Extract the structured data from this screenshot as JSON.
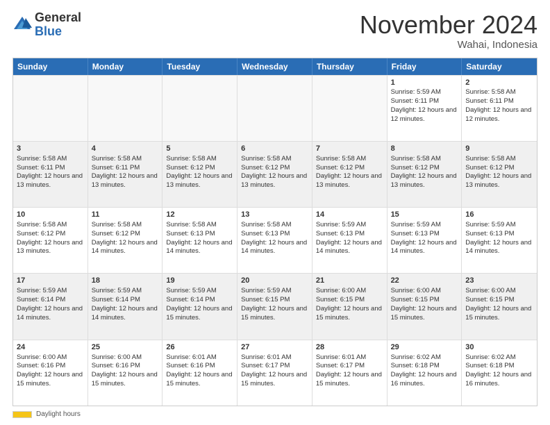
{
  "logo": {
    "general": "General",
    "blue": "Blue"
  },
  "title": "November 2024",
  "location": "Wahai, Indonesia",
  "days_header": [
    "Sunday",
    "Monday",
    "Tuesday",
    "Wednesday",
    "Thursday",
    "Friday",
    "Saturday"
  ],
  "footer": {
    "daylight_label": "Daylight hours"
  },
  "weeks": [
    [
      {
        "day": "",
        "sunrise": "",
        "sunset": "",
        "daylight": "",
        "empty": true
      },
      {
        "day": "",
        "sunrise": "",
        "sunset": "",
        "daylight": "",
        "empty": true
      },
      {
        "day": "",
        "sunrise": "",
        "sunset": "",
        "daylight": "",
        "empty": true
      },
      {
        "day": "",
        "sunrise": "",
        "sunset": "",
        "daylight": "",
        "empty": true
      },
      {
        "day": "",
        "sunrise": "",
        "sunset": "",
        "daylight": "",
        "empty": true
      },
      {
        "day": "1",
        "sunrise": "Sunrise: 5:59 AM",
        "sunset": "Sunset: 6:11 PM",
        "daylight": "Daylight: 12 hours and 12 minutes.",
        "empty": false
      },
      {
        "day": "2",
        "sunrise": "Sunrise: 5:58 AM",
        "sunset": "Sunset: 6:11 PM",
        "daylight": "Daylight: 12 hours and 12 minutes.",
        "empty": false
      }
    ],
    [
      {
        "day": "3",
        "sunrise": "Sunrise: 5:58 AM",
        "sunset": "Sunset: 6:11 PM",
        "daylight": "Daylight: 12 hours and 13 minutes.",
        "empty": false
      },
      {
        "day": "4",
        "sunrise": "Sunrise: 5:58 AM",
        "sunset": "Sunset: 6:11 PM",
        "daylight": "Daylight: 12 hours and 13 minutes.",
        "empty": false
      },
      {
        "day": "5",
        "sunrise": "Sunrise: 5:58 AM",
        "sunset": "Sunset: 6:12 PM",
        "daylight": "Daylight: 12 hours and 13 minutes.",
        "empty": false
      },
      {
        "day": "6",
        "sunrise": "Sunrise: 5:58 AM",
        "sunset": "Sunset: 6:12 PM",
        "daylight": "Daylight: 12 hours and 13 minutes.",
        "empty": false
      },
      {
        "day": "7",
        "sunrise": "Sunrise: 5:58 AM",
        "sunset": "Sunset: 6:12 PM",
        "daylight": "Daylight: 12 hours and 13 minutes.",
        "empty": false
      },
      {
        "day": "8",
        "sunrise": "Sunrise: 5:58 AM",
        "sunset": "Sunset: 6:12 PM",
        "daylight": "Daylight: 12 hours and 13 minutes.",
        "empty": false
      },
      {
        "day": "9",
        "sunrise": "Sunrise: 5:58 AM",
        "sunset": "Sunset: 6:12 PM",
        "daylight": "Daylight: 12 hours and 13 minutes.",
        "empty": false
      }
    ],
    [
      {
        "day": "10",
        "sunrise": "Sunrise: 5:58 AM",
        "sunset": "Sunset: 6:12 PM",
        "daylight": "Daylight: 12 hours and 13 minutes.",
        "empty": false
      },
      {
        "day": "11",
        "sunrise": "Sunrise: 5:58 AM",
        "sunset": "Sunset: 6:12 PM",
        "daylight": "Daylight: 12 hours and 14 minutes.",
        "empty": false
      },
      {
        "day": "12",
        "sunrise": "Sunrise: 5:58 AM",
        "sunset": "Sunset: 6:13 PM",
        "daylight": "Daylight: 12 hours and 14 minutes.",
        "empty": false
      },
      {
        "day": "13",
        "sunrise": "Sunrise: 5:58 AM",
        "sunset": "Sunset: 6:13 PM",
        "daylight": "Daylight: 12 hours and 14 minutes.",
        "empty": false
      },
      {
        "day": "14",
        "sunrise": "Sunrise: 5:59 AM",
        "sunset": "Sunset: 6:13 PM",
        "daylight": "Daylight: 12 hours and 14 minutes.",
        "empty": false
      },
      {
        "day": "15",
        "sunrise": "Sunrise: 5:59 AM",
        "sunset": "Sunset: 6:13 PM",
        "daylight": "Daylight: 12 hours and 14 minutes.",
        "empty": false
      },
      {
        "day": "16",
        "sunrise": "Sunrise: 5:59 AM",
        "sunset": "Sunset: 6:13 PM",
        "daylight": "Daylight: 12 hours and 14 minutes.",
        "empty": false
      }
    ],
    [
      {
        "day": "17",
        "sunrise": "Sunrise: 5:59 AM",
        "sunset": "Sunset: 6:14 PM",
        "daylight": "Daylight: 12 hours and 14 minutes.",
        "empty": false
      },
      {
        "day": "18",
        "sunrise": "Sunrise: 5:59 AM",
        "sunset": "Sunset: 6:14 PM",
        "daylight": "Daylight: 12 hours and 14 minutes.",
        "empty": false
      },
      {
        "day": "19",
        "sunrise": "Sunrise: 5:59 AM",
        "sunset": "Sunset: 6:14 PM",
        "daylight": "Daylight: 12 hours and 15 minutes.",
        "empty": false
      },
      {
        "day": "20",
        "sunrise": "Sunrise: 5:59 AM",
        "sunset": "Sunset: 6:15 PM",
        "daylight": "Daylight: 12 hours and 15 minutes.",
        "empty": false
      },
      {
        "day": "21",
        "sunrise": "Sunrise: 6:00 AM",
        "sunset": "Sunset: 6:15 PM",
        "daylight": "Daylight: 12 hours and 15 minutes.",
        "empty": false
      },
      {
        "day": "22",
        "sunrise": "Sunrise: 6:00 AM",
        "sunset": "Sunset: 6:15 PM",
        "daylight": "Daylight: 12 hours and 15 minutes.",
        "empty": false
      },
      {
        "day": "23",
        "sunrise": "Sunrise: 6:00 AM",
        "sunset": "Sunset: 6:15 PM",
        "daylight": "Daylight: 12 hours and 15 minutes.",
        "empty": false
      }
    ],
    [
      {
        "day": "24",
        "sunrise": "Sunrise: 6:00 AM",
        "sunset": "Sunset: 6:16 PM",
        "daylight": "Daylight: 12 hours and 15 minutes.",
        "empty": false
      },
      {
        "day": "25",
        "sunrise": "Sunrise: 6:00 AM",
        "sunset": "Sunset: 6:16 PM",
        "daylight": "Daylight: 12 hours and 15 minutes.",
        "empty": false
      },
      {
        "day": "26",
        "sunrise": "Sunrise: 6:01 AM",
        "sunset": "Sunset: 6:16 PM",
        "daylight": "Daylight: 12 hours and 15 minutes.",
        "empty": false
      },
      {
        "day": "27",
        "sunrise": "Sunrise: 6:01 AM",
        "sunset": "Sunset: 6:17 PM",
        "daylight": "Daylight: 12 hours and 15 minutes.",
        "empty": false
      },
      {
        "day": "28",
        "sunrise": "Sunrise: 6:01 AM",
        "sunset": "Sunset: 6:17 PM",
        "daylight": "Daylight: 12 hours and 15 minutes.",
        "empty": false
      },
      {
        "day": "29",
        "sunrise": "Sunrise: 6:02 AM",
        "sunset": "Sunset: 6:18 PM",
        "daylight": "Daylight: 12 hours and 16 minutes.",
        "empty": false
      },
      {
        "day": "30",
        "sunrise": "Sunrise: 6:02 AM",
        "sunset": "Sunset: 6:18 PM",
        "daylight": "Daylight: 12 hours and 16 minutes.",
        "empty": false
      }
    ]
  ]
}
